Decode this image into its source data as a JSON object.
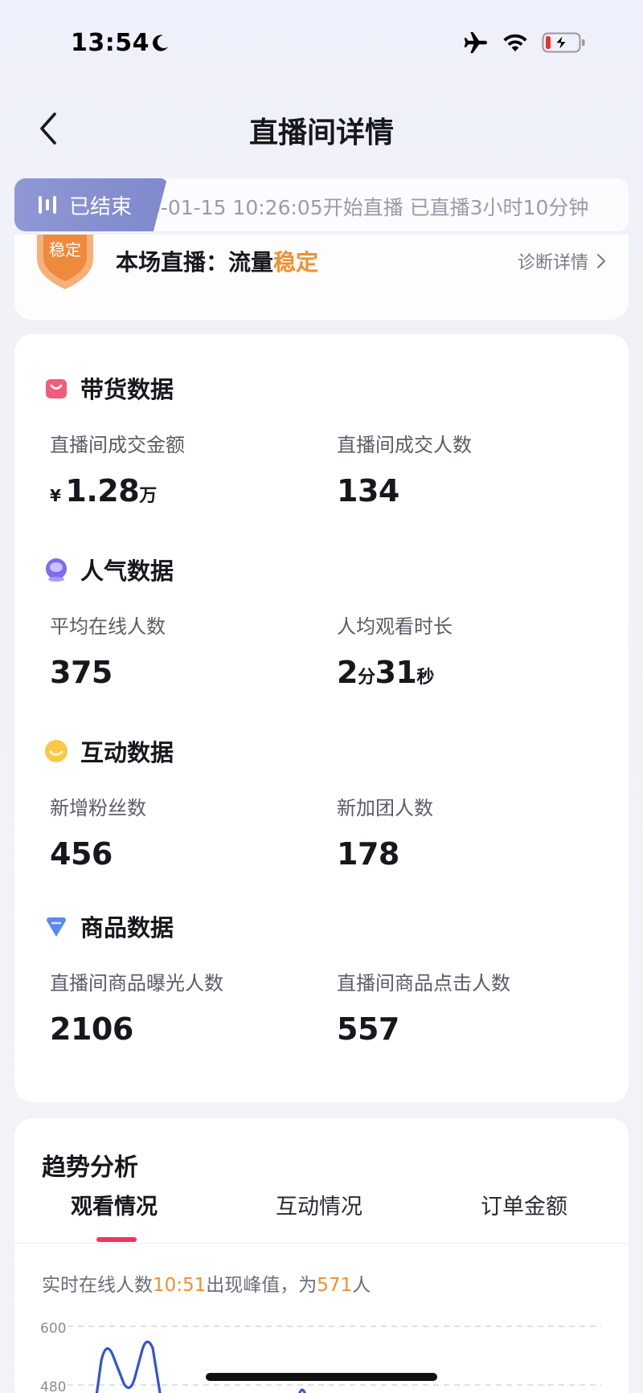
{
  "status_bar": {
    "time": "13:54"
  },
  "nav": {
    "title": "直播间详情"
  },
  "live": {
    "status": "已结束",
    "info": "24-01-15 10:26:05开始直播   已直播3小时10分钟"
  },
  "diagnosis": {
    "badge": "稳定",
    "prefix": "本场直播：流量",
    "highlight": "稳定",
    "link": "诊断详情"
  },
  "sections": {
    "sales": {
      "title": "带货数据",
      "left_label": "直播间成交金额",
      "left_currency": "¥",
      "left_value": "1.28",
      "left_unit": "万",
      "right_label": "直播间成交人数",
      "right_value": "134"
    },
    "popularity": {
      "title": "人气数据",
      "left_label": "平均在线人数",
      "left_value": "375",
      "right_label": "人均观看时长",
      "right_min": "2",
      "right_min_unit": "分",
      "right_sec": "31",
      "right_sec_unit": "秒"
    },
    "interaction": {
      "title": "互动数据",
      "left_label": "新增粉丝数",
      "left_value": "456",
      "right_label": "新加团人数",
      "right_value": "178"
    },
    "product": {
      "title": "商品数据",
      "left_label": "直播间商品曝光人数",
      "left_value": "2106",
      "right_label": "直播间商品点击人数",
      "right_value": "557"
    }
  },
  "trend": {
    "title": "趋势分析",
    "tabs": [
      "观看情况",
      "互动情况",
      "订单金额"
    ],
    "peak_prefix": "实时在线人数",
    "peak_time": "10:51",
    "peak_mid": "出现峰值，为",
    "peak_value": "571",
    "peak_suffix": "人",
    "y_ticks": [
      "600",
      "480"
    ]
  },
  "colors": {
    "accent_orange": "#f0902e",
    "tab_underline": "#f0355a",
    "badge_bg": "#858fcf",
    "chart_line": "#3552d6"
  }
}
